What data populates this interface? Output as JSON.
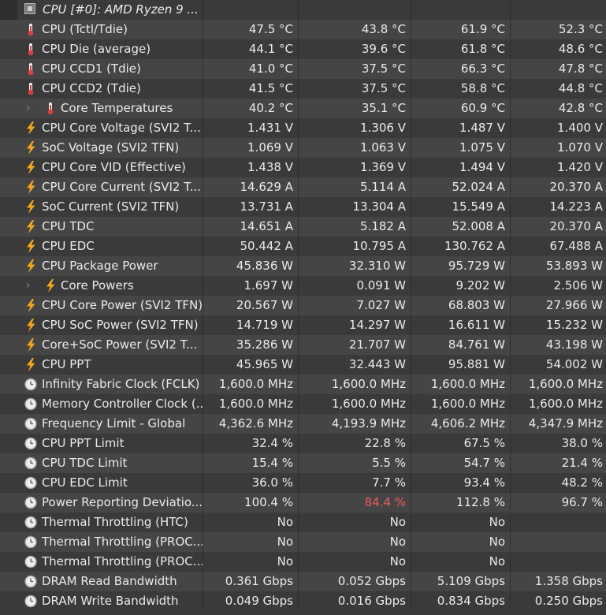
{
  "header": {
    "title": "CPU [#0]: AMD Ryzen 9 ...",
    "icon": "cpu-chip-icon"
  },
  "rows": [
    {
      "name": "CPU (Tctl/Tdie)",
      "icon": "thermometer",
      "expandable": false,
      "v": [
        "47.5 °C",
        "43.8 °C",
        "61.9 °C",
        "52.3 °C"
      ]
    },
    {
      "name": "CPU Die (average)",
      "icon": "thermometer",
      "expandable": false,
      "v": [
        "44.1 °C",
        "39.6 °C",
        "61.8 °C",
        "48.6 °C"
      ]
    },
    {
      "name": "CPU CCD1 (Tdie)",
      "icon": "thermometer",
      "expandable": false,
      "v": [
        "41.0 °C",
        "37.5 °C",
        "66.3 °C",
        "47.8 °C"
      ]
    },
    {
      "name": "CPU CCD2 (Tdie)",
      "icon": "thermometer",
      "expandable": false,
      "v": [
        "41.5 °C",
        "37.5 °C",
        "58.8 °C",
        "44.8 °C"
      ]
    },
    {
      "name": "Core Temperatures",
      "icon": "thermometer",
      "expandable": true,
      "v": [
        "40.2 °C",
        "35.1 °C",
        "60.9 °C",
        "42.8 °C"
      ]
    },
    {
      "name": "CPU Core Voltage (SVI2 T...",
      "icon": "lightning",
      "expandable": false,
      "v": [
        "1.431 V",
        "1.306 V",
        "1.487 V",
        "1.400 V"
      ]
    },
    {
      "name": "SoC Voltage (SVI2 TFN)",
      "icon": "lightning",
      "expandable": false,
      "v": [
        "1.069 V",
        "1.063 V",
        "1.075 V",
        "1.070 V"
      ]
    },
    {
      "name": "CPU Core VID (Effective)",
      "icon": "lightning",
      "expandable": false,
      "v": [
        "1.438 V",
        "1.369 V",
        "1.494 V",
        "1.420 V"
      ]
    },
    {
      "name": "CPU Core Current (SVI2 T...",
      "icon": "lightning",
      "expandable": false,
      "v": [
        "14.629 A",
        "5.114 A",
        "52.024 A",
        "20.370 A"
      ]
    },
    {
      "name": "SoC Current (SVI2 TFN)",
      "icon": "lightning",
      "expandable": false,
      "v": [
        "13.731 A",
        "13.304 A",
        "15.549 A",
        "14.223 A"
      ]
    },
    {
      "name": "CPU TDC",
      "icon": "lightning",
      "expandable": false,
      "v": [
        "14.651 A",
        "5.182 A",
        "52.008 A",
        "20.370 A"
      ]
    },
    {
      "name": "CPU EDC",
      "icon": "lightning",
      "expandable": false,
      "v": [
        "50.442 A",
        "10.795 A",
        "130.762 A",
        "67.488 A"
      ]
    },
    {
      "name": "CPU Package Power",
      "icon": "lightning",
      "expandable": false,
      "v": [
        "45.836 W",
        "32.310 W",
        "95.729 W",
        "53.893 W"
      ]
    },
    {
      "name": "Core Powers",
      "icon": "lightning",
      "expandable": true,
      "v": [
        "1.697 W",
        "0.091 W",
        "9.202 W",
        "2.506 W"
      ]
    },
    {
      "name": "CPU Core Power (SVI2 TFN)",
      "icon": "lightning",
      "expandable": false,
      "v": [
        "20.567 W",
        "7.027 W",
        "68.803 W",
        "27.966 W"
      ]
    },
    {
      "name": "CPU SoC Power (SVI2 TFN)",
      "icon": "lightning",
      "expandable": false,
      "v": [
        "14.719 W",
        "14.297 W",
        "16.611 W",
        "15.232 W"
      ]
    },
    {
      "name": "Core+SoC Power (SVI2 T...",
      "icon": "lightning",
      "expandable": false,
      "v": [
        "35.286 W",
        "21.707 W",
        "84.761 W",
        "43.198 W"
      ]
    },
    {
      "name": "CPU PPT",
      "icon": "lightning",
      "expandable": false,
      "v": [
        "45.965 W",
        "32.443 W",
        "95.881 W",
        "54.002 W"
      ]
    },
    {
      "name": "Infinity Fabric Clock (FCLK)",
      "icon": "clock",
      "expandable": false,
      "v": [
        "1,600.0 MHz",
        "1,600.0 MHz",
        "1,600.0 MHz",
        "1,600.0 MHz"
      ]
    },
    {
      "name": "Memory Controller Clock (...",
      "icon": "clock",
      "expandable": false,
      "v": [
        "1,600.0 MHz",
        "1,600.0 MHz",
        "1,600.0 MHz",
        "1,600.0 MHz"
      ]
    },
    {
      "name": "Frequency Limit - Global",
      "icon": "clock",
      "expandable": false,
      "v": [
        "4,362.6 MHz",
        "4,193.9 MHz",
        "4,606.2 MHz",
        "4,347.9 MHz"
      ]
    },
    {
      "name": "CPU PPT Limit",
      "icon": "clock",
      "expandable": false,
      "v": [
        "32.4 %",
        "22.8 %",
        "67.5 %",
        "38.0 %"
      ]
    },
    {
      "name": "CPU TDC Limit",
      "icon": "clock",
      "expandable": false,
      "v": [
        "15.4 %",
        "5.5 %",
        "54.7 %",
        "21.4 %"
      ]
    },
    {
      "name": "CPU EDC Limit",
      "icon": "clock",
      "expandable": false,
      "v": [
        "36.0 %",
        "7.7 %",
        "93.4 %",
        "48.2 %"
      ]
    },
    {
      "name": "Power Reporting Deviatio...",
      "icon": "clock",
      "expandable": false,
      "v": [
        "100.4 %",
        "84.4 %",
        "112.8 %",
        "96.7 %"
      ],
      "alert_col": 1
    },
    {
      "name": "Thermal Throttling (HTC)",
      "icon": "clock",
      "expandable": false,
      "v": [
        "No",
        "No",
        "No",
        ""
      ]
    },
    {
      "name": "Thermal Throttling (PROC...",
      "icon": "clock",
      "expandable": false,
      "v": [
        "No",
        "No",
        "No",
        ""
      ]
    },
    {
      "name": "Thermal Throttling (PROC...",
      "icon": "clock",
      "expandable": false,
      "v": [
        "No",
        "No",
        "No",
        ""
      ]
    },
    {
      "name": "DRAM Read Bandwidth",
      "icon": "clock",
      "expandable": false,
      "v": [
        "0.361 Gbps",
        "0.052 Gbps",
        "5.109 Gbps",
        "1.358 Gbps"
      ]
    },
    {
      "name": "DRAM Write Bandwidth",
      "icon": "clock",
      "expandable": false,
      "v": [
        "0.049 Gbps",
        "0.016 Gbps",
        "0.834 Gbps",
        "0.250 Gbps"
      ]
    }
  ],
  "colors": {
    "background": "#3a3a3a",
    "row_alt": "#454545",
    "text": "#eaeaea",
    "alert": "#f15a5a",
    "thermometer": "#d94040",
    "lightning": "#f2a81d",
    "clock": "#d8d8d8"
  }
}
